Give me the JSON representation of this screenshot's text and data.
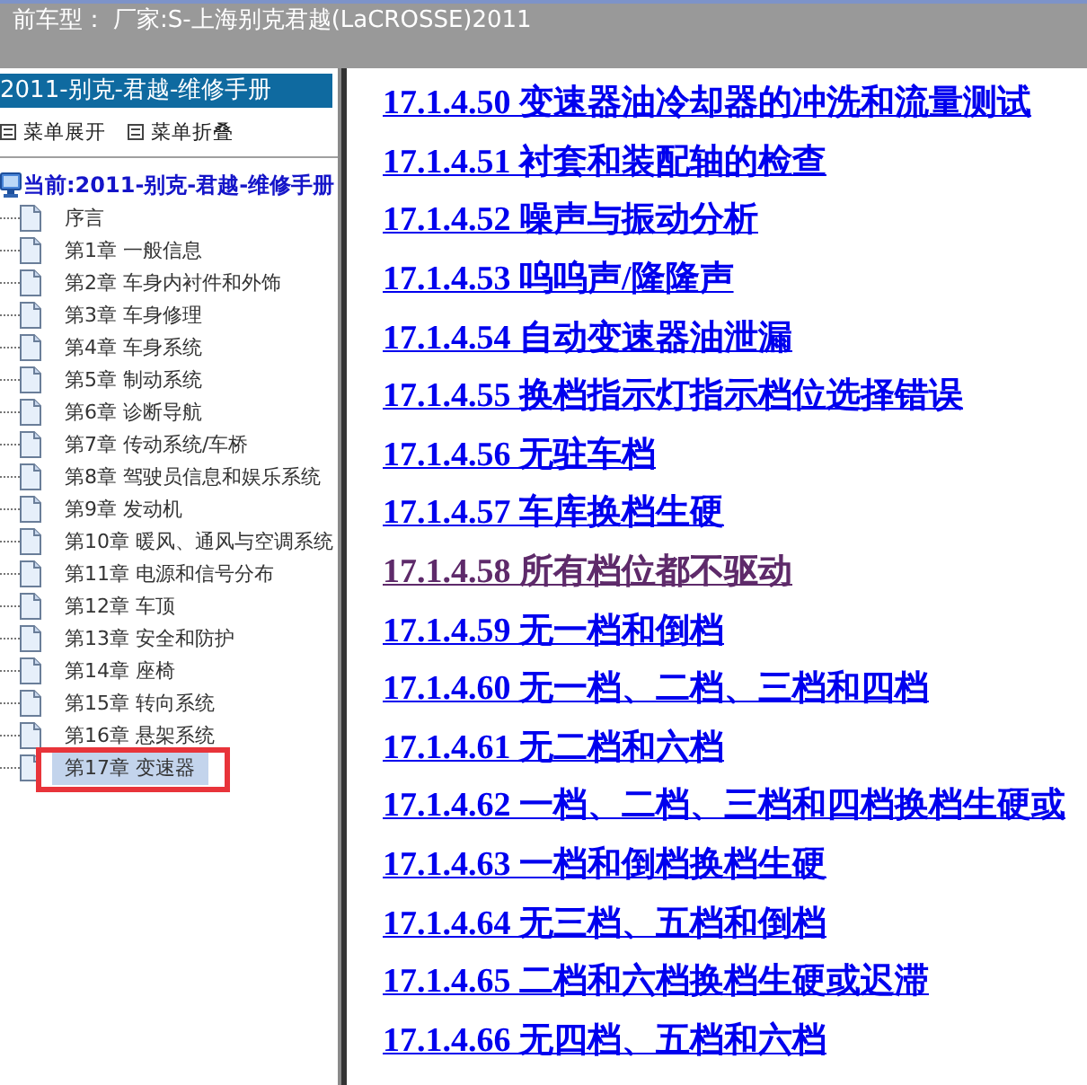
{
  "header": {
    "label": "前车型：",
    "value": "厂家:S-上海别克君越(LaCROSSE)2011"
  },
  "sidebar": {
    "title": "2011-别克-君越-维修手册",
    "menu_actions": [
      "菜单展开",
      "菜单折叠"
    ],
    "tree": {
      "label": "当前:2011-别克-君越-维修手册",
      "children": [
        {
          "label": "序言",
          "selected": false,
          "annotated": false
        },
        {
          "label": "第1章 一般信息",
          "selected": false,
          "annotated": false
        },
        {
          "label": "第2章 车身内衬件和外饰",
          "selected": false,
          "annotated": false
        },
        {
          "label": "第3章 车身修理",
          "selected": false,
          "annotated": false
        },
        {
          "label": "第4章 车身系统",
          "selected": false,
          "annotated": false
        },
        {
          "label": "第5章 制动系统",
          "selected": false,
          "annotated": false
        },
        {
          "label": "第6章 诊断导航",
          "selected": false,
          "annotated": false
        },
        {
          "label": "第7章 传动系统/车桥",
          "selected": false,
          "annotated": false
        },
        {
          "label": "第8章 驾驶员信息和娱乐系统",
          "selected": false,
          "annotated": false
        },
        {
          "label": "第9章 发动机",
          "selected": false,
          "annotated": false
        },
        {
          "label": "第10章 暖风、通风与空调系统",
          "selected": false,
          "annotated": false
        },
        {
          "label": "第11章 电源和信号分布",
          "selected": false,
          "annotated": false
        },
        {
          "label": "第12章 车顶",
          "selected": false,
          "annotated": false
        },
        {
          "label": "第13章 安全和防护",
          "selected": false,
          "annotated": false
        },
        {
          "label": "第14章 座椅",
          "selected": false,
          "annotated": false
        },
        {
          "label": "第15章 转向系统",
          "selected": false,
          "annotated": false
        },
        {
          "label": "第16章 悬架系统",
          "selected": false,
          "annotated": false
        },
        {
          "label": "第17章 变速器",
          "selected": true,
          "annotated": true
        }
      ]
    }
  },
  "content": {
    "links": [
      {
        "label": "17.1.4.50 变速器油冷却器的冲洗和流量测试",
        "visited": false
      },
      {
        "label": "17.1.4.51 衬套和装配轴的检查",
        "visited": false
      },
      {
        "label": "17.1.4.52 噪声与振动分析",
        "visited": false
      },
      {
        "label": "17.1.4.53 呜呜声/隆隆声",
        "visited": false
      },
      {
        "label": "17.1.4.54 自动变速器油泄漏",
        "visited": false
      },
      {
        "label": "17.1.4.55 换档指示灯指示档位选择错误",
        "visited": false
      },
      {
        "label": "17.1.4.56 无驻车档",
        "visited": false
      },
      {
        "label": "17.1.4.57 车库换档生硬",
        "visited": false
      },
      {
        "label": "17.1.4.58 所有档位都不驱动",
        "visited": true
      },
      {
        "label": "17.1.4.59 无一档和倒档",
        "visited": false
      },
      {
        "label": "17.1.4.60 无一档、二档、三档和四档",
        "visited": false
      },
      {
        "label": "17.1.4.61 无二档和六档",
        "visited": false
      },
      {
        "label": "17.1.4.62 一档、二档、三档和四档换档生硬或",
        "visited": false
      },
      {
        "label": "17.1.4.63 一档和倒档换档生硬",
        "visited": false
      },
      {
        "label": "17.1.4.64 无三档、五档和倒档",
        "visited": false
      },
      {
        "label": "17.1.4.65 二档和六档换档生硬或迟滞",
        "visited": false
      },
      {
        "label": "17.1.4.66 无四档、五档和六档",
        "visited": false
      }
    ]
  }
}
